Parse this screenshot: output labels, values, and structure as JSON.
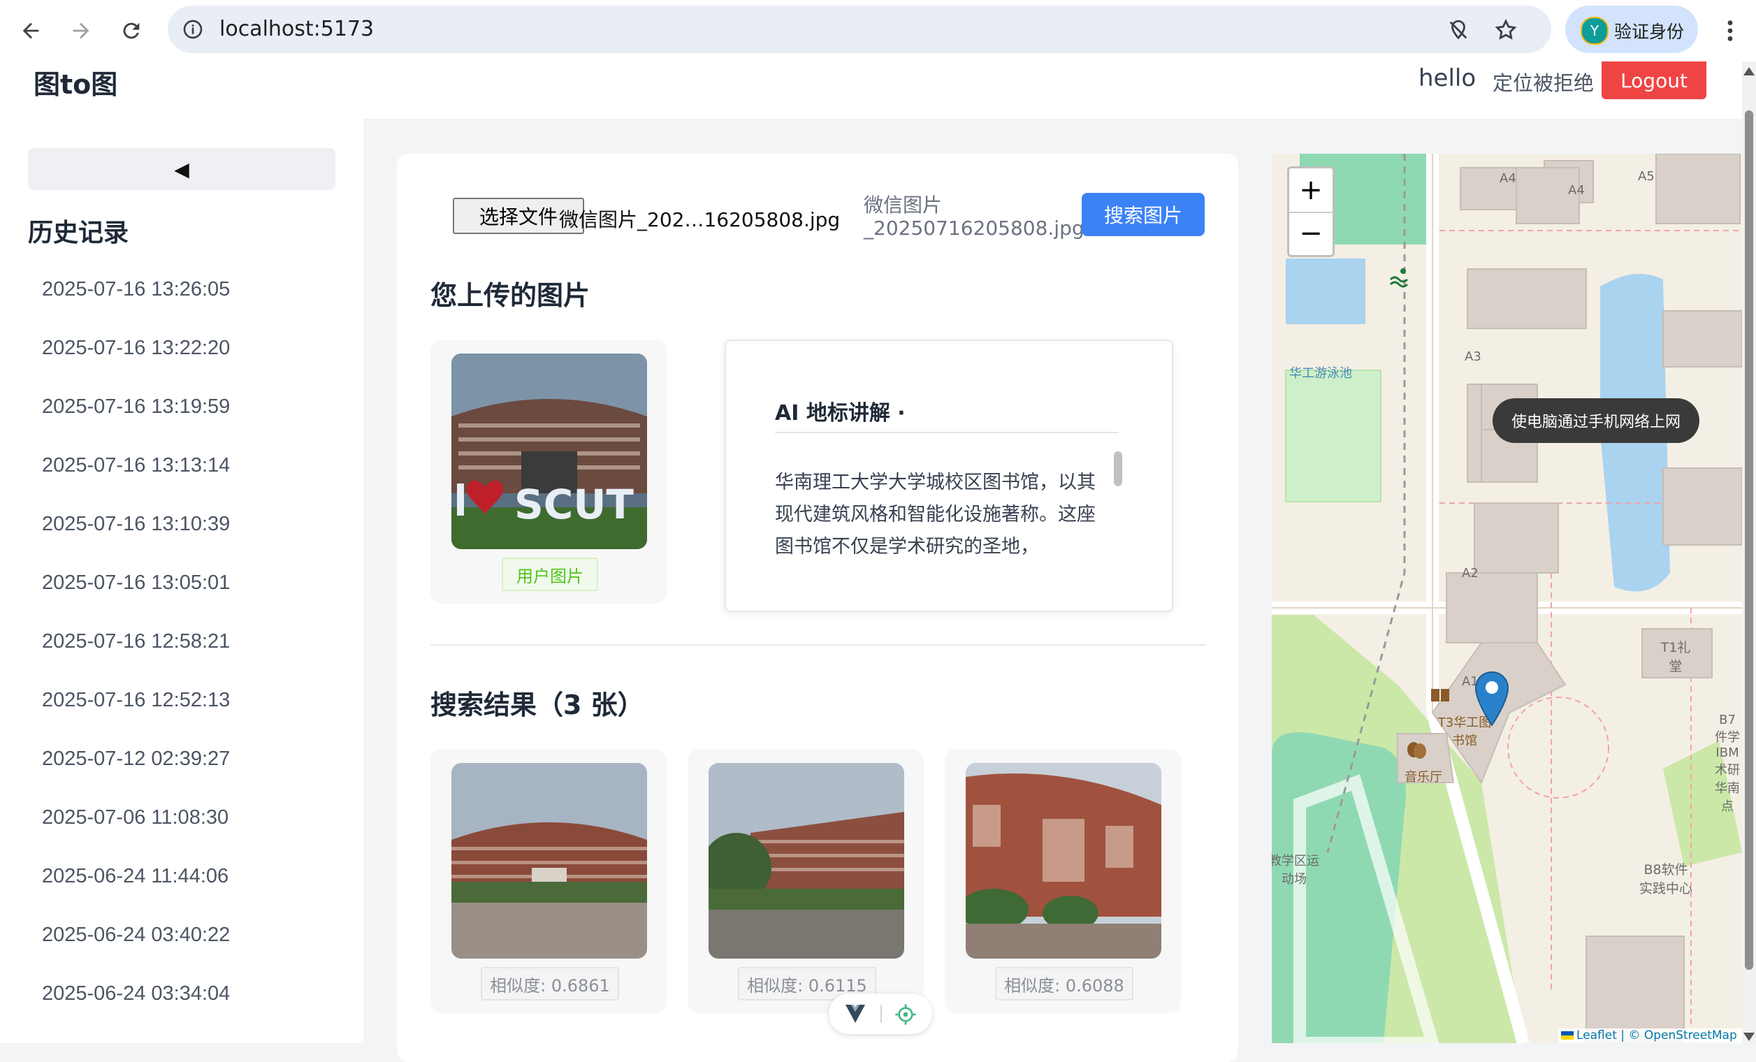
{
  "browser": {
    "url": "localhost:5173",
    "profile_initial": "Y",
    "profile_label": "验证身份"
  },
  "header": {
    "brand": "图to图",
    "greeting": "hello",
    "location_status": "定位被拒绝",
    "logout_label": "Logout"
  },
  "sidebar": {
    "collapse_glyph": "◀",
    "title": "历史记录",
    "items": [
      "2025-07-16 13:26:05",
      "2025-07-16 13:22:20",
      "2025-07-16 13:19:59",
      "2025-07-16 13:13:14",
      "2025-07-16 13:10:39",
      "2025-07-16 13:05:01",
      "2025-07-16 12:58:21",
      "2025-07-16 12:52:13",
      "2025-07-12 02:39:27",
      "2025-07-06 11:08:30",
      "2025-06-24 11:44:06",
      "2025-06-24 03:40:22",
      "2025-06-24 03:34:04"
    ]
  },
  "upload": {
    "file_button": "选择文件",
    "file_name": "微信图片_202…16205808.jpg",
    "selected_line1": "微信图片",
    "selected_line2": "_20250716205808.jpg",
    "search_button": "搜索图片"
  },
  "uploaded": {
    "heading": "您上传的图片",
    "tag": "用户图片",
    "ai_title": "AI 地标讲解 ·",
    "ai_text": "华南理工大学大学城校区图书馆，以其现代建筑风格和智能化设施著称。这座图书馆不仅是学术研究的圣地，"
  },
  "results": {
    "heading": "搜索结果（3 张）",
    "items": [
      {
        "score": "相似度: 0.6861"
      },
      {
        "score": "相似度: 0.6115"
      },
      {
        "score": "相似度: 0.6088"
      }
    ]
  },
  "map": {
    "zoom_in": "+",
    "zoom_out": "−",
    "tooltip": "使电脑通过手机网络上网",
    "attribution": "Leaflet | © OpenStreetMap",
    "labels": {
      "a1": "A1",
      "a2": "A2",
      "a3": "A3",
      "a4a": "A4",
      "a4b": "A4",
      "a5": "A5",
      "pool": "华工游泳池",
      "library": "T3华工图书馆",
      "music": "音乐厅",
      "t1": "T1礼堂",
      "b8": "B8软件实践中心",
      "field": "教学区运动场",
      "b7": "B7件学IBM术研华南点"
    }
  },
  "colors": {
    "accent_blue": "#3b82f6",
    "logout_red": "#ef4444",
    "tag_green": "#52c41a"
  }
}
